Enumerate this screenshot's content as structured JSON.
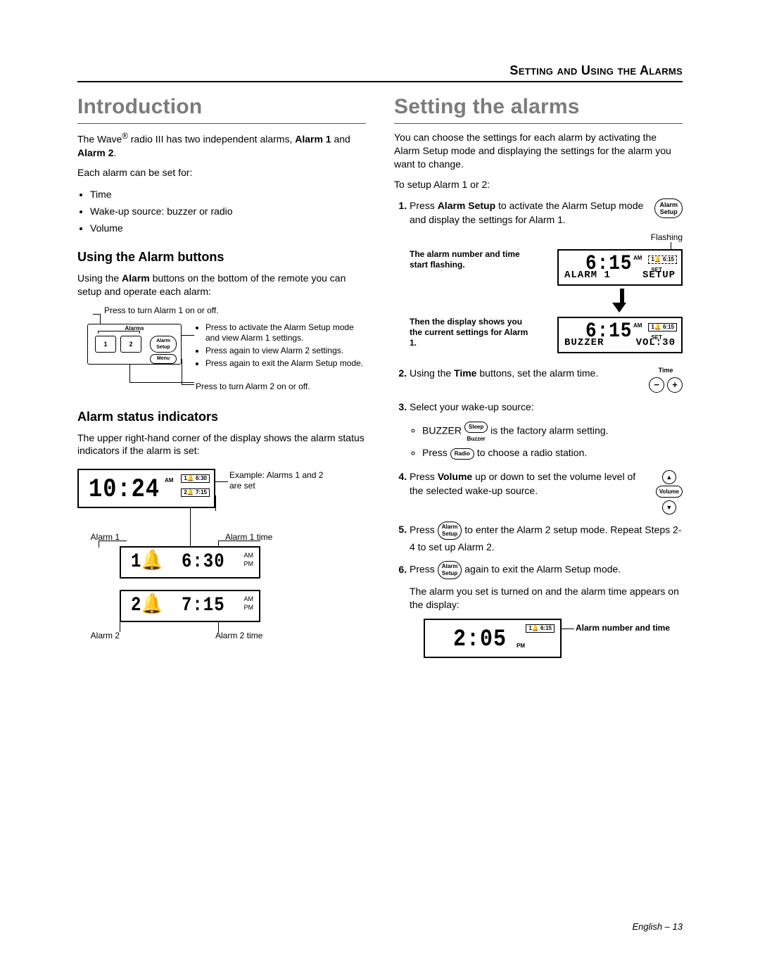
{
  "header": {
    "section": "Setting and Using the Alarms"
  },
  "left": {
    "h1": "Introduction",
    "intro_pre": "The Wave",
    "intro_mid": " radio III has two independent alarms, ",
    "intro_b1": "Alarm 1",
    "intro_and": " and ",
    "intro_b2": "Alarm 2",
    "intro_post": ".",
    "each": "Each alarm can be set for:",
    "bullets": {
      "b0": "Time",
      "b1": "Wake-up source: buzzer or radio",
      "b2": "Volume"
    },
    "h2a": "Using the Alarm buttons",
    "using_p_pre": "Using the ",
    "using_p_b": "Alarm",
    "using_p_post": " buttons on the bottom of the remote you can setup and operate each alarm:",
    "remote": {
      "cap_top": "Press to turn Alarm 1 on or off.",
      "label_top": "Alarms",
      "btn1": "1",
      "btn2": "2",
      "btnA": "Alarm\nSetup",
      "btnM": "Menu",
      "cap_r1": "Press to activate the Alarm Setup mode and view Alarm 1 settings.",
      "cap_r2": "Press again to view Alarm 2 settings.",
      "cap_r3": "Press again to exit the Alarm Setup mode.",
      "cap_bottom": "Press to turn Alarm 2 on or off."
    },
    "h2b": "Alarm status indicators",
    "status_p": "The upper right-hand corner of the display shows the alarm status indicators if the alarm is set:",
    "status": {
      "clock": "10:24",
      "clock_ampm": "AM",
      "abox1": "1🔔 6:30",
      "abox2": "2🔔 7:15",
      "example": "Example: Alarms 1 and 2 are set",
      "a1lab": "Alarm 1",
      "a1tlab": "Alarm 1 time",
      "a2lab": "Alarm 2",
      "a2tlab": "Alarm 2 time",
      "d1_n": "1🔔",
      "d1_t": "6:30",
      "d1_am": "AM",
      "d1_pm": "PM",
      "d2_n": "2🔔",
      "d2_t": "7:15",
      "d2_am": "AM",
      "d2_pm": "PM"
    }
  },
  "right": {
    "h1": "Setting the alarms",
    "p1": "You can choose the settings for each alarm by activating the Alarm Setup mode and displaying the settings for the alarm you want to change.",
    "p2": "To setup Alarm 1 or 2:",
    "step1_pre": "Press ",
    "step1_b": "Alarm Setup",
    "step1_post": " to activate the Alarm Setup mode and display the settings for Alarm 1.",
    "icon_alarm_setup": "Alarm\nSetup",
    "setup": {
      "flashing": "Flashing",
      "note1": "The alarm number and time start flashing.",
      "big1": "6:15",
      "big1_ampm": "AM",
      "abox": "1🔔 6:15",
      "l1a": "ALARM 1",
      "l1b": "SETUP",
      "note2": "Then the display shows you the current settings for Alarm 1.",
      "big2": "6:15",
      "big2_ampm": "AM",
      "set": "SET",
      "l2a": "BUZZER",
      "l2b": "VOL:30"
    },
    "step2_pre": "Using the ",
    "step2_b": "Time",
    "step2_post": " buttons, set the alarm time.",
    "time_label": "Time",
    "time_minus": "−",
    "time_plus": "+",
    "step3": "Select your wake-up source:",
    "step3_b1_pre": "BUZZER ",
    "step3_b1_icon": "Sleep",
    "step3_b1_buz": "Buzzer",
    "step3_b1_post": " is the factory alarm setting.",
    "step3_b2_pre": "Press ",
    "step3_b2_icon": "Radio",
    "step3_b2_post": " to choose a radio station.",
    "step4_pre": "Press ",
    "step4_b": "Volume",
    "step4_post": " up or down to set the volume level of the selected wake-up source.",
    "vol_label": "Volume",
    "vol_up": "▲",
    "vol_down": "▼",
    "step5_pre": "Press ",
    "step5_icon": "Alarm\nSetup",
    "step5_post": " to enter the Alarm 2 setup mode. Repeat Steps 2-4 to set up Alarm 2.",
    "step6_pre": "Press ",
    "step6_icon": "Alarm\nSetup",
    "step6_post": " again to exit the Alarm Setup mode.",
    "final_p": "The alarm you set is turned on and the alarm time appears on the display:",
    "final": {
      "big": "2:05",
      "pm": "PM",
      "abox": "1🔔 6:15",
      "label": "Alarm number and time"
    }
  },
  "footer": "English – 13"
}
